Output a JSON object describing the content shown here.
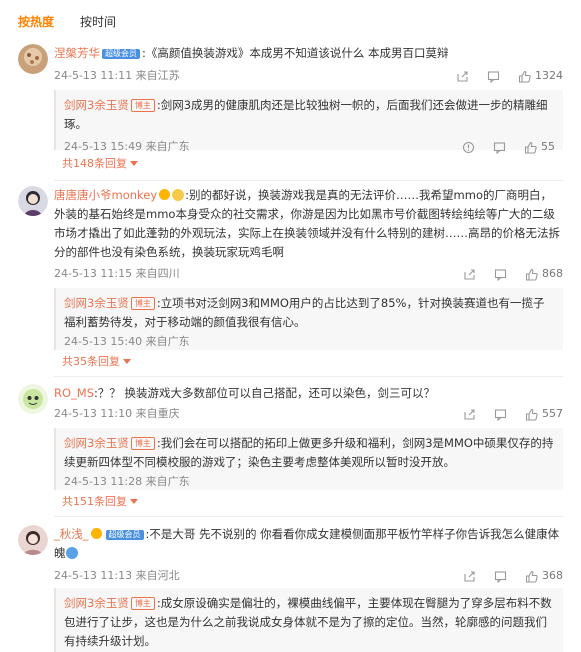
{
  "tabs": {
    "hot": "按热度",
    "time": "按时间"
  },
  "comments": [
    {
      "user": "涅槃芳华",
      "vip": "超级会员",
      "text": ":《高颜值换装游戏》本成男不知道该说什么 本成男百口莫辩",
      "time": "24-5-13 11:11",
      "loc": "来自江苏",
      "likes": "1324",
      "reply": {
        "user": "剑网3余玉贤",
        "badge": "博主",
        "text": ":剑网3成男的健康肌肉还是比较独树一帜的，后面我们还会做进一步的精雕细琢。",
        "time": "24-5-13 15:49",
        "loc": "来自广东",
        "likes": "55"
      },
      "more": "共148条回复"
    },
    {
      "user": "唐唐唐小爷monkey",
      "text": ":别的都好说，换装游戏我是真的无法评价……我希望mmo的厂商明白，外装的基石始终是mmo本身受众的社交需求，你游是因为比如黑市号价截图转绘纯绘等广大的二级市场才撬出了如此蓬勃的外观玩法，实际上在换装领域并没有什么特别的建树……高昂的价格无法拆分的部件也没有染色系统，换装玩家玩鸡毛啊",
      "time": "24-5-13 11:15",
      "loc": "来自四川",
      "likes": "868",
      "reply": {
        "user": "剑网3余玉贤",
        "badge": "博主",
        "text": ":立项书对泛剑网3和MMO用户的占比达到了85%，针对换装赛道也有一揽子福利蓄势待发，对于移动端的颜值我很有信心。",
        "time": "24-5-13 15:40",
        "loc": "来自广东"
      },
      "more": "共35条回复"
    },
    {
      "user": "RO_MS",
      "text": ":？？ 换装游戏大多数部位可以自己搭配，还可以染色，剑三可以？",
      "time": "24-5-13 11:10",
      "loc": "来自重庆",
      "likes": "557",
      "reply": {
        "user": "剑网3余玉贤",
        "badge": "博主",
        "text": ":我们会在可以搭配的拓印上做更多升级和福利，剑网3是MMO中硕果仅存的持续更新四体型不同模校服的游戏了；染色主要考虑整体美观所以暂时没开放。",
        "time": "24-5-13 11:28",
        "loc": "来自广东"
      },
      "more": "共151条回复"
    },
    {
      "user": "_秋浅_",
      "vip": "超级会员",
      "text": ":不是大哥 先不说别的 你看看你成女建模侧面那平板竹竿样子你告诉我怎么健康体魄",
      "time": "24-5-13 11:13",
      "loc": "来自河北",
      "likes": "368",
      "reply": {
        "user": "剑网3余玉贤",
        "badge": "博主",
        "text": ":成女原设确实是偏壮的，裸模曲线偏平，主要体现在臀腿为了穿多层布料不数包进行了让步，这也是为什么之前我说成女身体就不是为了擦的定位。当然，轮廓感的问题我们有持续升级计划。"
      }
    }
  ],
  "icons": {
    "share": "share-icon",
    "comment": "comment-icon",
    "like": "thumbs-up-icon",
    "report": "report-icon"
  },
  "colors": {
    "accent": "#ff8200",
    "username": "#eb7350",
    "meta": "#888888",
    "reply_bg": "#f7f7f7"
  }
}
